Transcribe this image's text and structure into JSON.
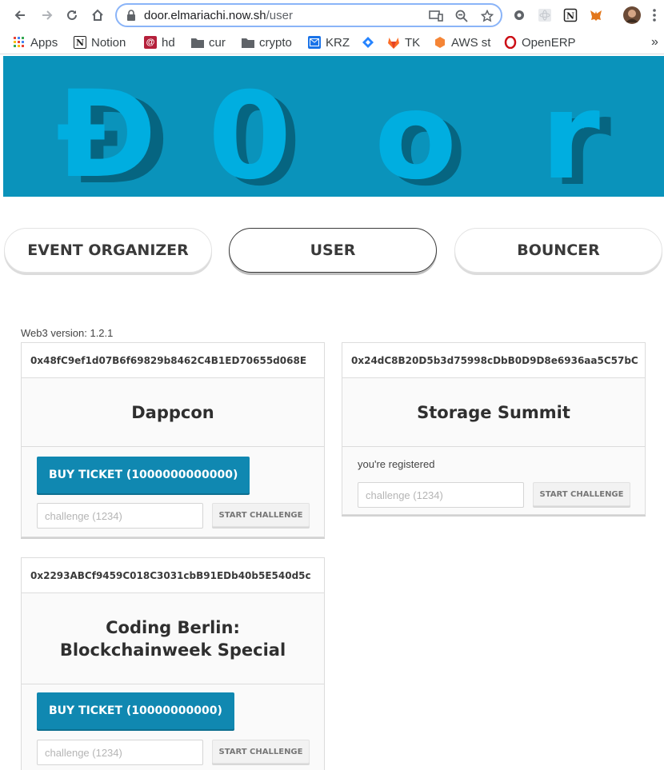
{
  "browser": {
    "url_host": "door.elmariachi.now.sh",
    "url_path": "/user",
    "bookmarks": [
      {
        "label": "Apps",
        "icon": "apps-grid-icon"
      },
      {
        "label": "Notion",
        "icon": "notion-icon"
      },
      {
        "label": "hd",
        "icon": "hd-icon"
      },
      {
        "label": "cur",
        "icon": "folder-icon"
      },
      {
        "label": "crypto",
        "icon": "folder-icon"
      },
      {
        "label": "KRZ",
        "icon": "mail-icon"
      },
      {
        "label": "",
        "icon": "diamond-icon"
      },
      {
        "label": "TK",
        "icon": "gitlab-icon"
      },
      {
        "label": "AWS st",
        "icon": "aws-icon"
      },
      {
        "label": "OpenERP",
        "icon": "opera-icon"
      }
    ],
    "overflow": "»"
  },
  "hero": {
    "logo_letters": [
      "Đ",
      "0",
      "o",
      "r"
    ],
    "colors": {
      "background": "#0a93bb",
      "letter": "#00aee0",
      "shadow": "#05566e"
    }
  },
  "tabs": [
    {
      "label": "EVENT ORGANIZER",
      "active": false
    },
    {
      "label": "USER",
      "active": true
    },
    {
      "label": "BOUNCER",
      "active": false
    }
  ],
  "web3_version": "Web3 version: 1.2.1",
  "events": [
    {
      "address": "0x48fC9ef1d07B6f69829b8462C4B1ED70655d068E",
      "name": "Dappcon",
      "buy_label": "BUY TICKET (1000000000000)",
      "challenge_placeholder": "challenge (1234)",
      "challenge_button": "START CHALLENGE"
    },
    {
      "address": "0x24dC8B20D5b3d75998cDbB0D9D8e6936aa5C57bC",
      "name": "Storage Summit",
      "status": "you're registered",
      "challenge_placeholder": "challenge (1234)",
      "challenge_button": "START CHALLENGE"
    },
    {
      "address": "0x2293ABCf9459C018C3031cbB91EDb40b5E540d5c",
      "name_line1": "Coding Berlin:",
      "name_line2": "Blockchainweek Special",
      "buy_label": "BUY TICKET (10000000000)",
      "challenge_placeholder": "challenge (1234)",
      "challenge_button": "START CHALLENGE"
    }
  ]
}
